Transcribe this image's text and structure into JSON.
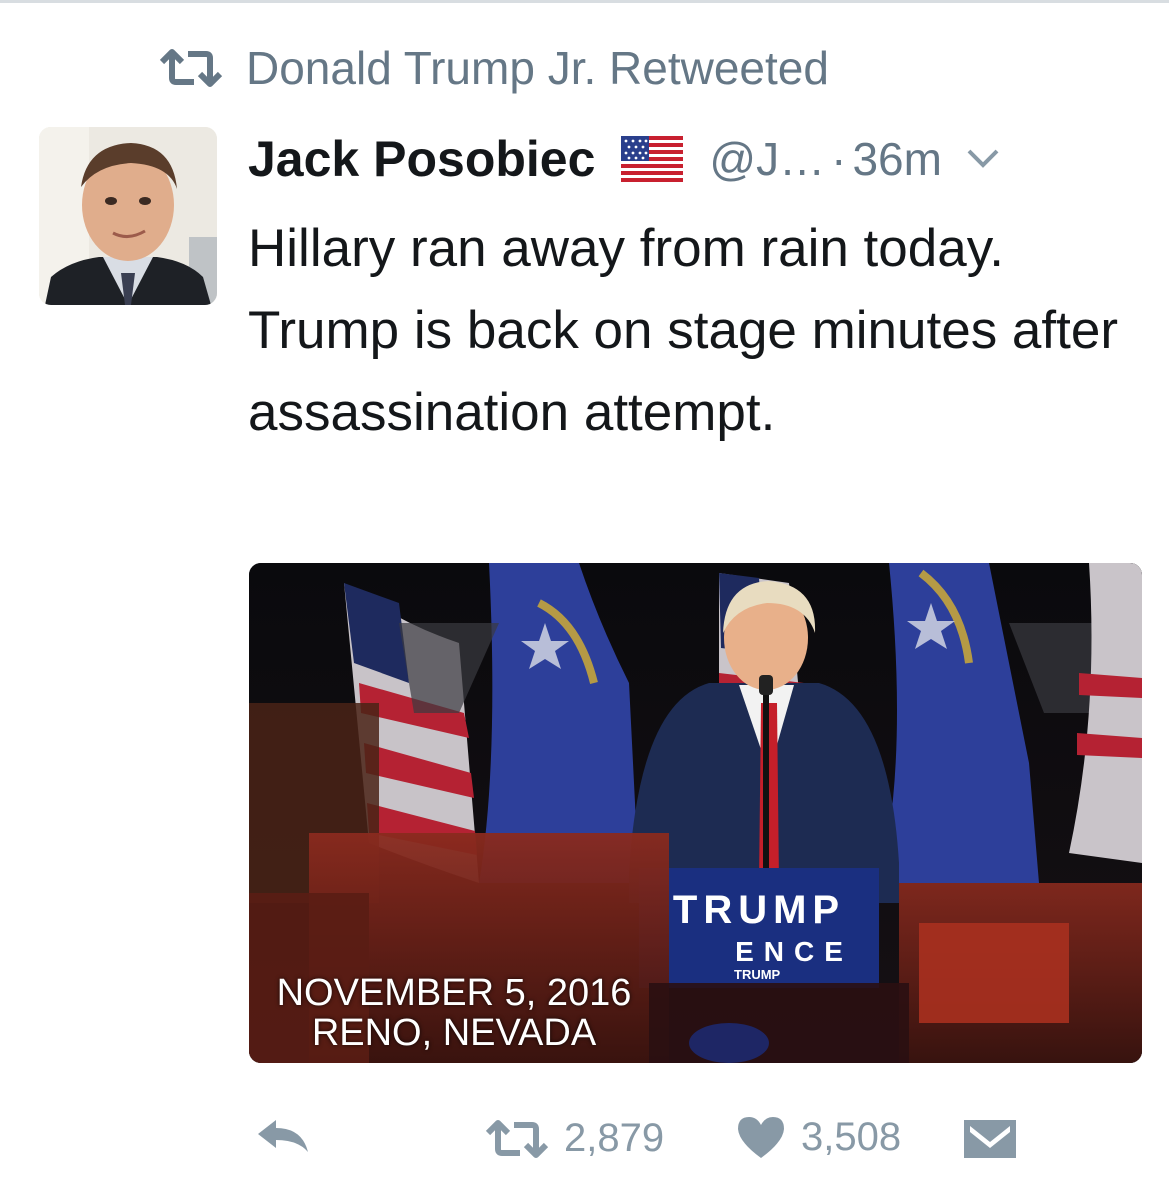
{
  "retweet_context": {
    "text": "Donald Trump Jr. Retweeted",
    "icon": "retweet-icon"
  },
  "tweet": {
    "author_name": "Jack Posobiec",
    "handle": "@J…",
    "separator": "·",
    "time": "36m",
    "text": "Hillary ran away from rain today. Trump is back on stage minutes after assassination attempt.",
    "flag_icon": "us-flag-icon",
    "menu_icon": "chevron-down-icon"
  },
  "media": {
    "sign_line1": "TRUMP",
    "sign_line2": "ENCE",
    "sign_line3": "TRUMP",
    "caption_line1": "NOVEMBER 5, 2016",
    "caption_line2": "RENO, NEVADA"
  },
  "actions": {
    "reply_icon": "reply-icon",
    "retweet_count": "2,879",
    "like_count": "3,508",
    "dm_icon": "envelope-icon"
  },
  "colors": {
    "secondary_text": "#657786",
    "action_gray": "#8899a6",
    "primary_text": "#14171a"
  }
}
